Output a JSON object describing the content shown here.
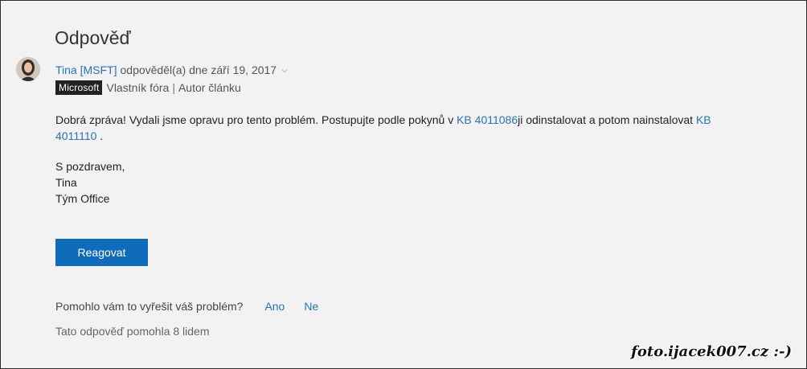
{
  "answer": {
    "heading": "Odpověď",
    "author": "Tina [MSFT]",
    "replied": "odpověděl(a) dne září 19, 2017",
    "badge": "Microsoft",
    "role1": "Vlastník fóra",
    "separator": "|",
    "role2": "Autor článku",
    "body_part1": "Dobrá zpráva! Vydali jsme opravu pro tento problém.  Postupujte podle pokynů v ",
    "kb1": "KB 4011086",
    "body_part2": "ji odinstalovat a potom nainstalovat ",
    "kb2": "KB 4011110",
    "body_part3": " .",
    "sig_line1": "S pozdravem,",
    "sig_line2": "Tina",
    "sig_line3": "Tým Office"
  },
  "actions": {
    "reply_label": "Reagovat",
    "helpful_question": "Pomohlo vám to vyřešit váš problém?",
    "yes": "Ano",
    "no": "Ne",
    "helpful_count": "Tato odpověď pomohla 8 lidem"
  },
  "watermark": "foto.ijacek007.cz :-)",
  "colors": {
    "link": "#2a72b5",
    "button": "#0f6cbd",
    "badge_bg": "#222222",
    "background": "#f2f2f2"
  },
  "icons": {
    "avatar": "avatar",
    "chevron": "chevron-down-icon"
  }
}
